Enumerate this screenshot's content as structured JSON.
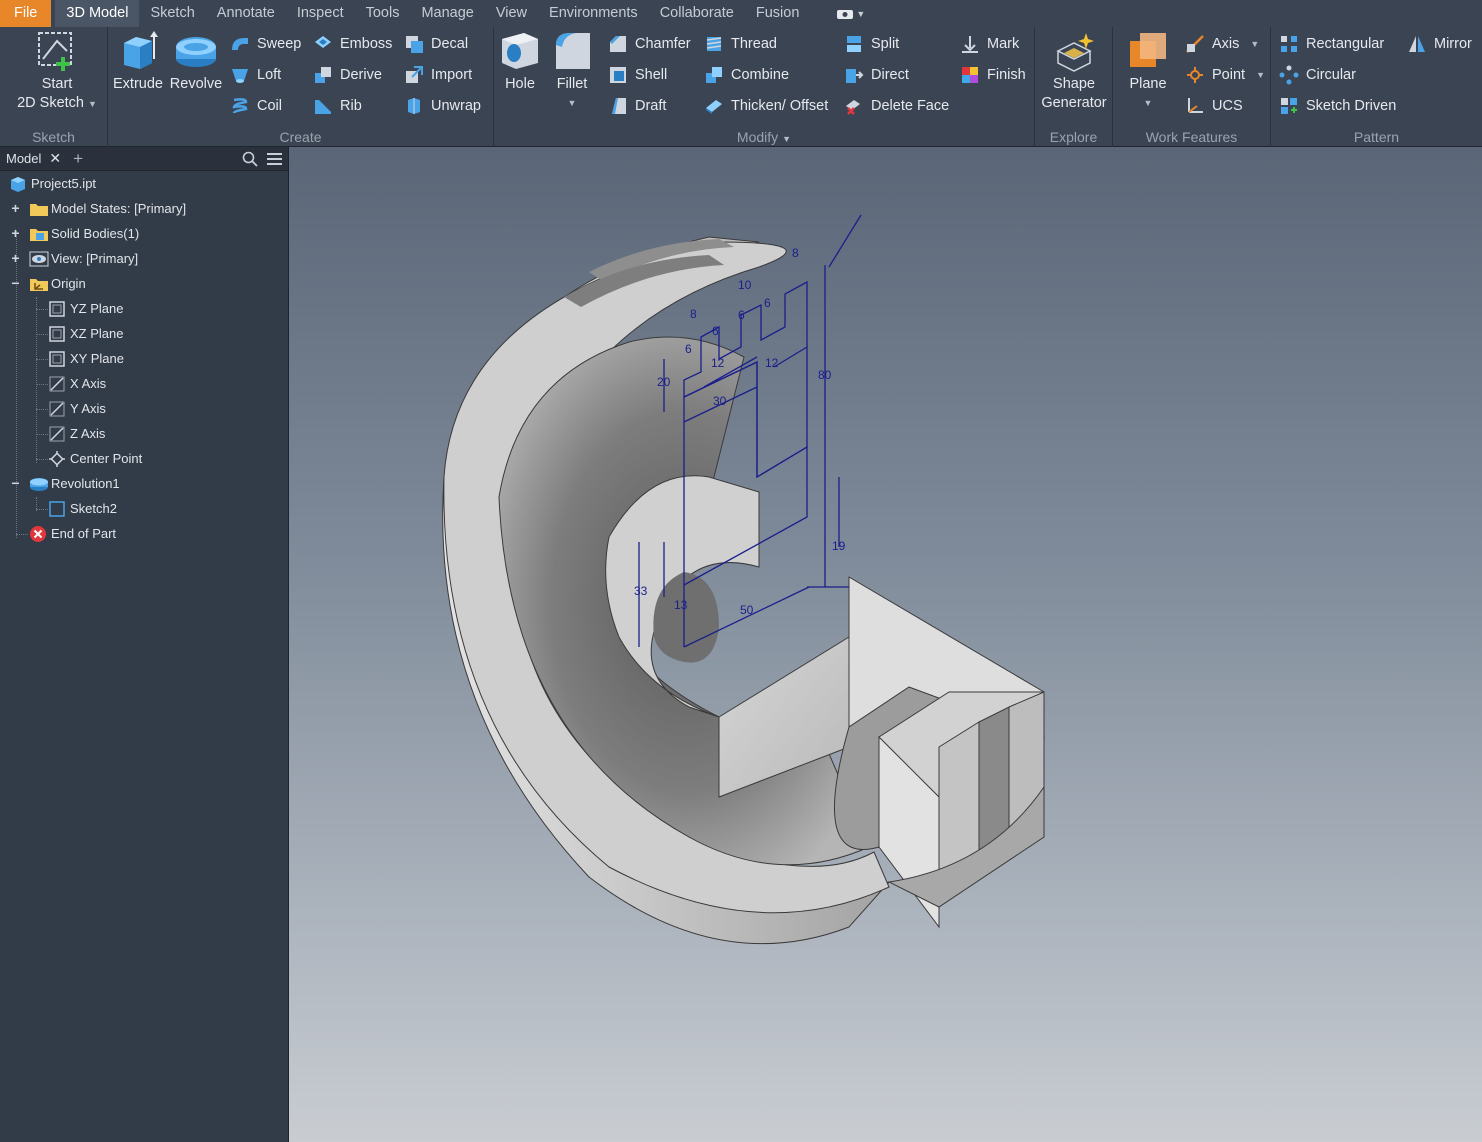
{
  "menubar": {
    "tabs": [
      "File",
      "3D Model",
      "Sketch",
      "Annotate",
      "Inspect",
      "Tools",
      "Manage",
      "View",
      "Environments",
      "Collaborate",
      "Fusion"
    ],
    "active": "3D Model"
  },
  "ribbon": {
    "sketch": {
      "title": "Sketch",
      "start_line1": "Start",
      "start_line2": "2D Sketch"
    },
    "create": {
      "title": "Create",
      "extrude": "Extrude",
      "revolve": "Revolve",
      "sweep": "Sweep",
      "loft": "Loft",
      "coil": "Coil",
      "emboss": "Emboss",
      "derive": "Derive",
      "rib": "Rib",
      "decal": "Decal",
      "import": "Import",
      "unwrap": "Unwrap"
    },
    "modify": {
      "title": "Modify",
      "hole": "Hole",
      "fillet": "Fillet",
      "chamfer": "Chamfer",
      "shell": "Shell",
      "draft": "Draft",
      "thread": "Thread",
      "combine": "Combine",
      "thicken": "Thicken/ Offset",
      "split": "Split",
      "direct": "Direct",
      "delete_face": "Delete Face",
      "mark": "Mark",
      "finish": "Finish"
    },
    "explore": {
      "title": "Explore",
      "shape_line1": "Shape",
      "shape_line2": "Generator"
    },
    "work_features": {
      "title": "Work Features",
      "plane": "Plane",
      "axis": "Axis",
      "point": "Point",
      "ucs": "UCS"
    },
    "pattern": {
      "title": "Pattern",
      "rectangular": "Rectangular",
      "circular": "Circular",
      "sketch_driven": "Sketch Driven",
      "mirror": "Mirror"
    }
  },
  "browser": {
    "tab": "Model",
    "items": [
      {
        "label": "Project5.ipt"
      },
      {
        "label": "Model States: [Primary]"
      },
      {
        "label": "Solid Bodies(1)"
      },
      {
        "label": "View: [Primary]"
      },
      {
        "label": "Origin"
      },
      {
        "label": "YZ Plane"
      },
      {
        "label": "XZ Plane"
      },
      {
        "label": "XY Plane"
      },
      {
        "label": "X Axis"
      },
      {
        "label": "Y Axis"
      },
      {
        "label": "Z Axis"
      },
      {
        "label": "Center Point"
      },
      {
        "label": "Revolution1"
      },
      {
        "label": "Sketch2"
      },
      {
        "label": "End of Part"
      }
    ]
  },
  "sketch_dimensions": [
    "8",
    "10",
    "6",
    "6",
    "8",
    "6",
    "6",
    "12",
    "12",
    "20",
    "30",
    "80",
    "19",
    "33",
    "13",
    "50"
  ],
  "colors": {
    "accent_file": "#e8862a",
    "sketch_line": "#1a1f8a",
    "ribbon_bg": "#3b4453",
    "browser_bg": "#323b48"
  }
}
